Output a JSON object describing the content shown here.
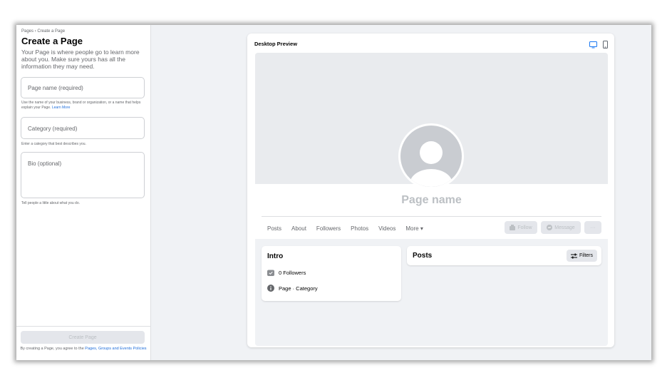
{
  "sidebar": {
    "breadcrumb": "Pages › Create a Page",
    "title": "Create a Page",
    "intro": "Your Page is where people go to learn more about you. Make sure yours has all the information they may need.",
    "page_name_placeholder": "Page name (required)",
    "page_name_hint": "Use the name of your business, brand or organization, or a name that helps explain your Page.",
    "learn_more": "Learn More",
    "category_placeholder": "Category (required)",
    "category_hint": "Enter a category that best describes you.",
    "bio_placeholder": "Bio (optional)",
    "bio_hint": "Tell people a little about what you do.",
    "create_button": "Create Page",
    "terms_prefix": "By creating a Page, you agree to the",
    "terms_link": "Pages, Groups and Events Policies"
  },
  "preview": {
    "title": "Desktop Preview",
    "icons": [
      "desktop-icon",
      "mobile-icon"
    ],
    "page_name": "Page name",
    "tabs": [
      "Posts",
      "About",
      "Followers",
      "Photos",
      "Videos",
      "More ▾"
    ],
    "actions": {
      "follow": "Follow",
      "message": "Message",
      "more": "···"
    },
    "intro_card": {
      "title": "Intro",
      "followers": "0 Followers",
      "page_category": "Page · Category"
    },
    "posts_card": {
      "title": "Posts",
      "filters": "Filters"
    }
  },
  "colors": {
    "link": "#216fdb",
    "accent_icon": "#1877f2",
    "disabled_text": "#bcc0c4"
  }
}
